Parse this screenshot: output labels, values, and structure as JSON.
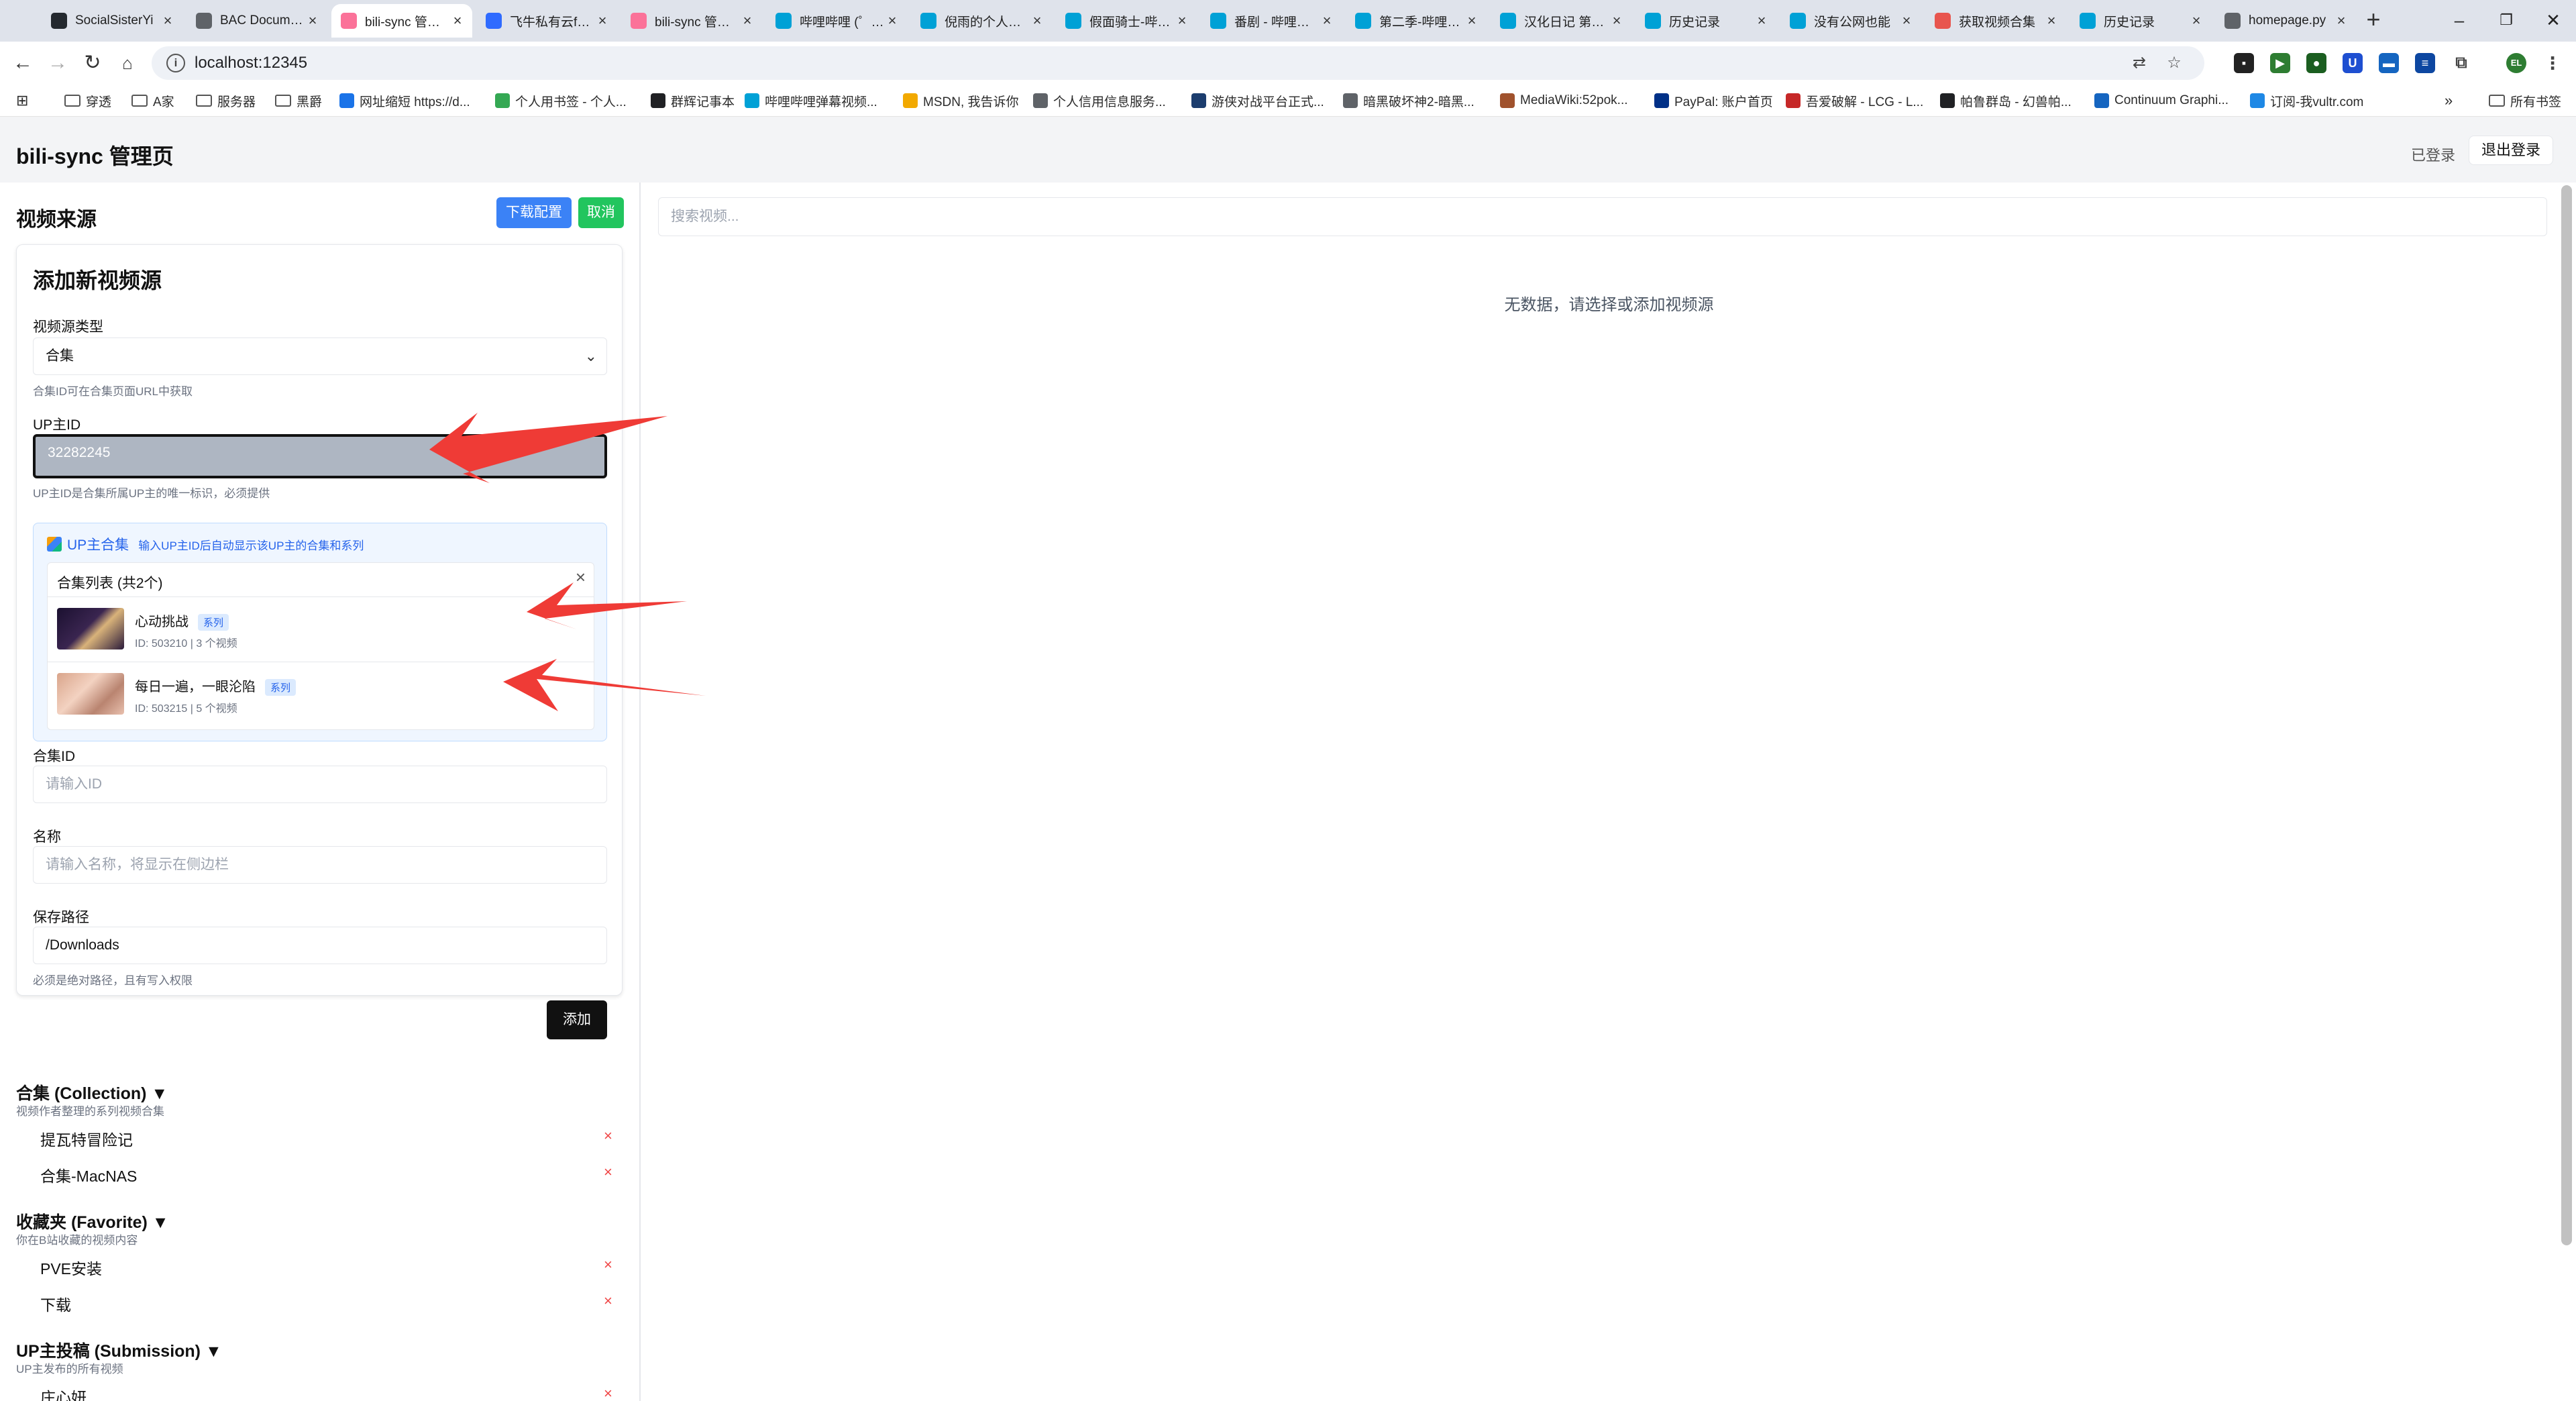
{
  "browser": {
    "tabs": [
      {
        "title": "SocialSisterYi",
        "icon_color": "#24292f",
        "icon": "github-icon"
      },
      {
        "title": "BAC Documentation",
        "icon_color": "#5f6368",
        "icon": "globe-icon"
      },
      {
        "title": "bili-sync 管理页",
        "icon_color": "#fb7299",
        "icon": "bili-sync-icon",
        "active": true
      },
      {
        "title": "飞牛私有云fnOS",
        "icon_color": "#2f6bff",
        "icon": "fnos-icon"
      },
      {
        "title": "bili-sync 管理页",
        "icon_color": "#fb7299",
        "icon": "bili-sync-icon"
      },
      {
        "title": "哔哩哔哩 (゜-゜)つロ",
        "icon_color": "#00a1d6",
        "icon": "bilibili-icon"
      },
      {
        "title": "倪雨的个人空间",
        "icon_color": "#00a1d6",
        "icon": "bilibili-icon"
      },
      {
        "title": "假面骑士-哔哩哔哩",
        "icon_color": "#00a1d6",
        "icon": "bilibili-icon"
      },
      {
        "title": "番剧 - 哔哩哔哩",
        "icon_color": "#00a1d6",
        "icon": "bilibili-icon"
      },
      {
        "title": "第二季-哔哩哔哩",
        "icon_color": "#00a1d6",
        "icon": "bilibili-icon"
      },
      {
        "title": "汉化日记 第二季",
        "icon_color": "#00a1d6",
        "icon": "bilibili-icon"
      },
      {
        "title": "历史记录",
        "icon_color": "#00a1d6",
        "icon": "bilibili-icon"
      },
      {
        "title": "没有公网也能",
        "icon_color": "#00a1d6",
        "icon": "bilibili-icon"
      },
      {
        "title": "获取视频合集",
        "icon_color": "#e8554e",
        "icon": "page-icon"
      },
      {
        "title": "历史记录",
        "icon_color": "#00a1d6",
        "icon": "bilibili-icon"
      },
      {
        "title": "homepage.py",
        "icon_color": "#5f6368",
        "icon": "globe-icon"
      }
    ],
    "url": "localhost:12345",
    "bookmarks": [
      {
        "label": "穿透",
        "type": "folder"
      },
      {
        "label": "A家",
        "type": "folder"
      },
      {
        "label": "服务器",
        "type": "folder"
      },
      {
        "label": "黑爵",
        "type": "folder"
      },
      {
        "label": "网址缩短 https://d...",
        "type": "link",
        "color": "#1a73e8"
      },
      {
        "label": "个人用书签 - 个人...",
        "type": "link",
        "color": "#34a853"
      },
      {
        "label": "群辉记事本",
        "type": "link",
        "color": "#202124"
      },
      {
        "label": "哔哩哔哩弹幕视频...",
        "type": "link",
        "color": "#00a1d6"
      },
      {
        "label": "MSDN, 我告诉你",
        "type": "link",
        "color": "#f2a900"
      },
      {
        "label": "个人信用信息服务...",
        "type": "link",
        "color": "#5f6368"
      },
      {
        "label": "游侠对战平台正式...",
        "type": "link",
        "color": "#1c3d6e"
      },
      {
        "label": "暗黑破坏神2-暗黑...",
        "type": "link",
        "color": "#5f6368"
      },
      {
        "label": "MediaWiki:52pok...",
        "type": "link",
        "color": "#a0522d"
      },
      {
        "label": "PayPal: 账户首页",
        "type": "link",
        "color": "#003087"
      },
      {
        "label": "吾爱破解 - LCG - L...",
        "type": "link",
        "color": "#c62828"
      },
      {
        "label": "帕鲁群岛 - 幻兽帕...",
        "type": "link",
        "color": "#202124"
      },
      {
        "label": "Continuum Graphi...",
        "type": "link",
        "color": "#1565c0"
      },
      {
        "label": "订阅-我vultr.com",
        "type": "link",
        "color": "#1e88e5"
      }
    ],
    "all_bookmarks_label": "所有书签",
    "profile_initials": "EL"
  },
  "app": {
    "title": "bili-sync 管理页",
    "login_status": "已登录",
    "logout_label": "退出登录"
  },
  "left": {
    "section_title": "视频来源",
    "download_config_label": "下载配置",
    "cancel_label": "取消",
    "form": {
      "title": "添加新视频源",
      "type_label": "视频源类型",
      "type_value": "合集",
      "type_help": "合集ID可在合集页面URL中获取",
      "upid_label": "UP主ID",
      "upid_value": "32282245",
      "upid_help": "UP主ID是合集所属UP主的唯一标识，必须提供",
      "up_box_title": "UP主合集",
      "up_box_hint": "输入UP主ID后自动显示该UP主的合集和系列",
      "collection_list_title": "合集列表 (共2个)",
      "collections": [
        {
          "name": "心动挑战",
          "badge": "系列",
          "meta": "ID: 503210 | 3 个视频"
        },
        {
          "name": "每日一遍，一眼沦陷",
          "badge": "系列",
          "meta": "ID: 503215 | 5 个视频"
        }
      ],
      "collection_id_label": "合集ID",
      "collection_id_placeholder": "请输入ID",
      "name_label": "名称",
      "name_placeholder": "请输入名称，将显示在侧边栏",
      "path_label": "保存路径",
      "path_value": "/Downloads",
      "path_help": "必须是绝对路径，且有写入权限",
      "add_label": "添加"
    },
    "groups": [
      {
        "title": "合集 (Collection) ▼",
        "desc": "视频作者整理的系列视频合集",
        "items": [
          "提瓦特冒险记",
          "合集-MacNAS"
        ]
      },
      {
        "title": "收藏夹 (Favorite) ▼",
        "desc": "你在B站收藏的视频内容",
        "items": [
          "PVE安装",
          "下载"
        ]
      },
      {
        "title": "UP主投稿 (Submission) ▼",
        "desc": "UP主发布的所有视频",
        "items": [
          "庄心妍"
        ]
      }
    ],
    "remove_glyph": "×"
  },
  "right": {
    "search_placeholder": "搜索视频...",
    "empty_message": "无数据，请选择或添加视频源"
  },
  "colors": {
    "primary": "#3b82f6",
    "success": "#22c55e",
    "danger": "#ef4444",
    "annotation_arrow": "#ef3b36"
  }
}
